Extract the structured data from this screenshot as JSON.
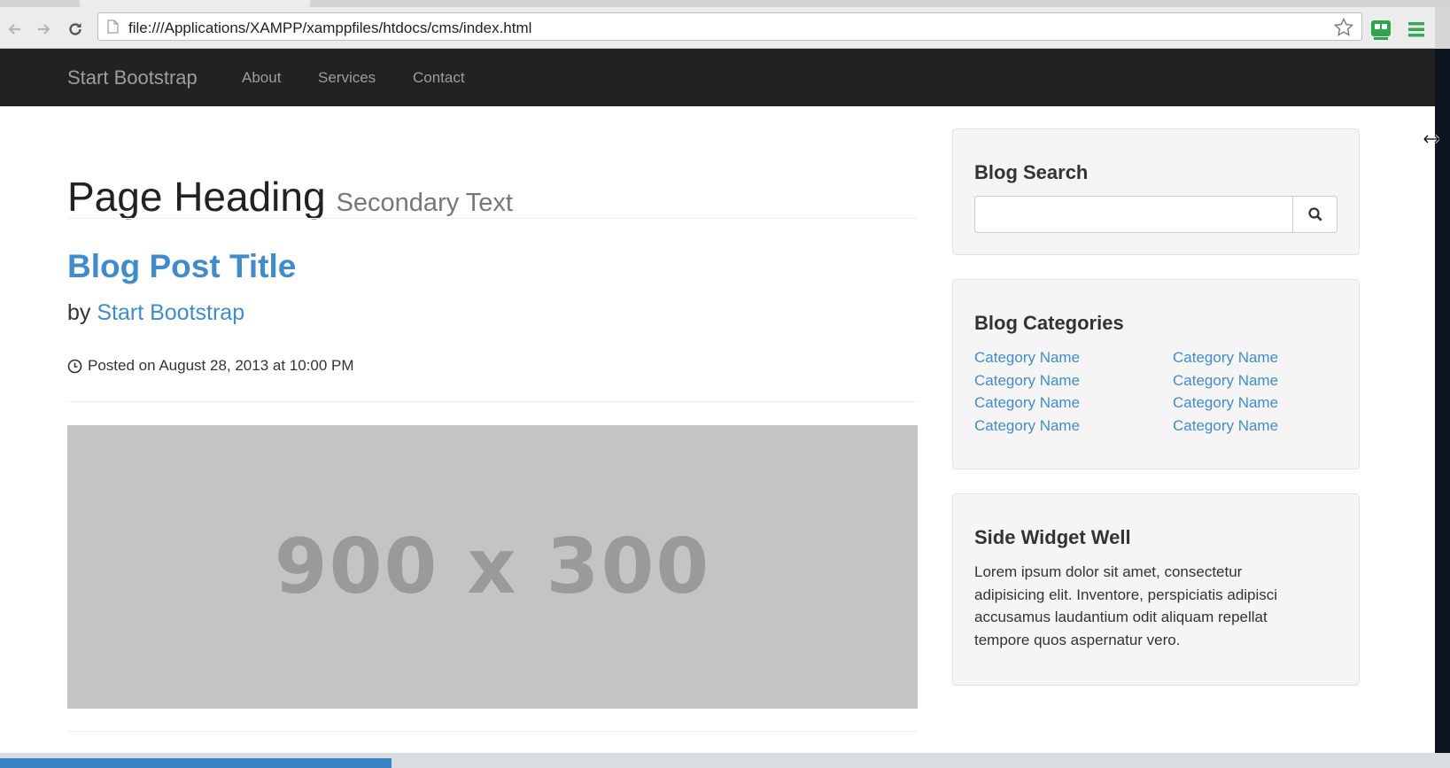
{
  "browser": {
    "url": "file:///Applications/XAMPP/xamppfiles/htdocs/cms/index.html",
    "icons": {
      "back": "back-arrow-icon",
      "forward": "forward-arrow-icon",
      "reload": "reload-icon",
      "bookmark": "star-icon",
      "extension": "extension-icon",
      "menu": "hamburger-menu-icon"
    }
  },
  "navbar": {
    "brand": "Start Bootstrap",
    "links": [
      "About",
      "Services",
      "Contact"
    ]
  },
  "main": {
    "heading": "Page Heading",
    "heading_secondary": "Secondary Text",
    "post_title": "Blog Post Title",
    "by_prefix": "by",
    "author": "Start Bootstrap",
    "posted": "Posted on August 28, 2013 at 10:00 PM",
    "image_placeholder": "900 x 300"
  },
  "sidebar": {
    "search": {
      "title": "Blog Search",
      "placeholder": ""
    },
    "categories": {
      "title": "Blog Categories",
      "left": [
        "Category Name",
        "Category Name",
        "Category Name",
        "Category Name"
      ],
      "right": [
        "Category Name",
        "Category Name",
        "Category Name",
        "Category Name"
      ]
    },
    "widget": {
      "title": "Side Widget Well",
      "text": "Lorem ipsum dolor sit amet, consectetur adipisicing elit. Inventore, perspiciatis adipisci accusamus laudantium odit aliquam repellat tempore quos aspernatur vero."
    }
  },
  "status": {
    "load_progress": 0.27
  },
  "colors": {
    "link": "#428bca",
    "navbar": "#222222",
    "well": "#f5f5f5",
    "progress": "#3a83c4"
  }
}
